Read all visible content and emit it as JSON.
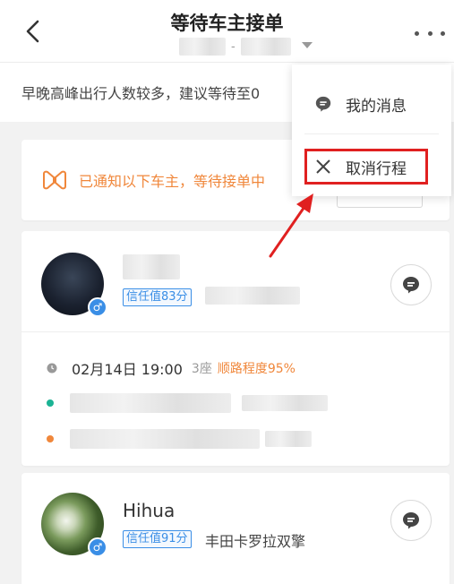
{
  "header": {
    "title": "等待车主接单",
    "subtitle_separator": "-"
  },
  "notice": {
    "text": "早晚高峰出行人数较多，建议等待至0"
  },
  "status": {
    "text": "已通知以下车主，等待接单中"
  },
  "drivers": [
    {
      "name": "",
      "trust_label": "信任值83分",
      "car_model": "",
      "trip": {
        "time": "02月14日 19:00",
        "seats": "3座",
        "match": "顺路程度95%"
      }
    },
    {
      "name": "Hihua",
      "trust_label": "信任值91分",
      "car_model": "丰田卡罗拉双擎"
    }
  ],
  "popup_menu": {
    "items": [
      {
        "label": "我的消息",
        "icon": "message-bubble-icon"
      },
      {
        "label": "取消行程",
        "icon": "close-x-icon"
      }
    ]
  },
  "colors": {
    "accent_orange": "#f0873b",
    "trust_blue": "#3a8ee6",
    "highlight_red": "#e02020",
    "origin_dot": "#1bb394",
    "destination_dot": "#f0873b"
  }
}
